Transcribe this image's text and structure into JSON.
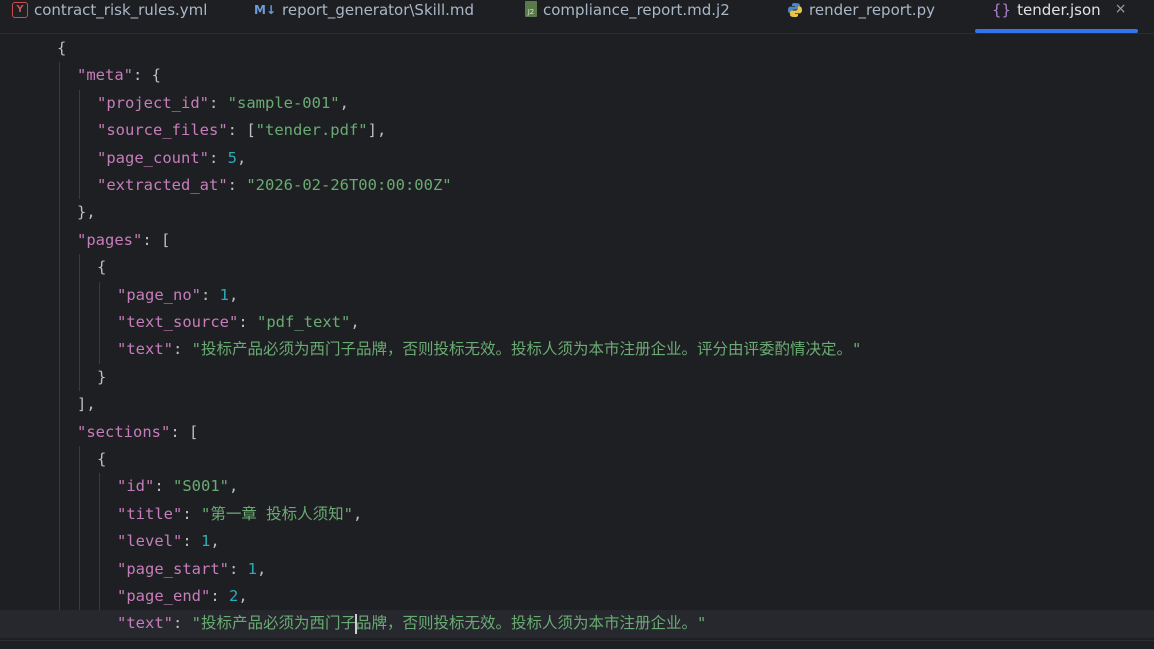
{
  "tabs": [
    {
      "label": "contract_risk_rules.yml",
      "icon": "yaml-file-icon",
      "icon_text": "Y",
      "active": false
    },
    {
      "label": "report_generator\\Skill.md",
      "icon": "markdown-file-icon",
      "icon_text": "M↓",
      "active": false
    },
    {
      "label": "compliance_report.md.j2",
      "icon": "jinja2-file-icon",
      "icon_text": "J2",
      "active": false
    },
    {
      "label": "render_report.py",
      "icon": "python-file-icon",
      "icon_text": "",
      "active": false
    },
    {
      "label": "tender.json",
      "icon": "json-file-icon",
      "icon_text": "{}",
      "active": true
    }
  ],
  "close_symbol": "×",
  "editor": {
    "lines": [
      {
        "t": "{"
      },
      {
        "k": "\"meta\"",
        "r": ": {"
      },
      {
        "k": "\"project_id\"",
        "r": ": ",
        "s": "\"sample-001\"",
        "e": ","
      },
      {
        "k": "\"source_files\"",
        "r": ": [",
        "s": "\"tender.pdf\"",
        "e": "],"
      },
      {
        "k": "\"page_count\"",
        "r": ": ",
        "n": "5",
        "e": ","
      },
      {
        "k": "\"extracted_at\"",
        "r": ": ",
        "s": "\"2026-02-26T00:00:00Z\"",
        "e": ""
      },
      {
        "t": "},"
      },
      {
        "k": "\"pages\"",
        "r": ": ["
      },
      {
        "t": "{"
      },
      {
        "k": "\"page_no\"",
        "r": ": ",
        "n": "1",
        "e": ","
      },
      {
        "k": "\"text_source\"",
        "r": ": ",
        "s": "\"pdf_text\"",
        "e": ","
      },
      {
        "k": "\"text\"",
        "r": ": ",
        "s": "\"投标产品必须为西门子品牌，否则投标无效。投标人须为本市注册企业。评分由评委酌情决定。\"",
        "e": ""
      },
      {
        "t": "}"
      },
      {
        "t": "],"
      },
      {
        "k": "\"sections\"",
        "r": ": ["
      },
      {
        "t": "{"
      },
      {
        "k": "\"id\"",
        "r": ": ",
        "s": "\"S001\"",
        "e": ","
      },
      {
        "k": "\"title\"",
        "r": ": ",
        "s": "\"第一章 投标人须知\"",
        "e": ","
      },
      {
        "k": "\"level\"",
        "r": ": ",
        "n": "1",
        "e": ","
      },
      {
        "k": "\"page_start\"",
        "r": ": ",
        "n": "1",
        "e": ","
      },
      {
        "k": "\"page_end\"",
        "r": ": ",
        "n": "2",
        "e": ","
      },
      {
        "k": "\"text\"",
        "r": ": ",
        "s_before": "\"投标产品必须为西门子",
        "s_after": "品牌，否则投标无效。投标人须为本市注册企业。\"",
        "e": ""
      }
    ]
  }
}
